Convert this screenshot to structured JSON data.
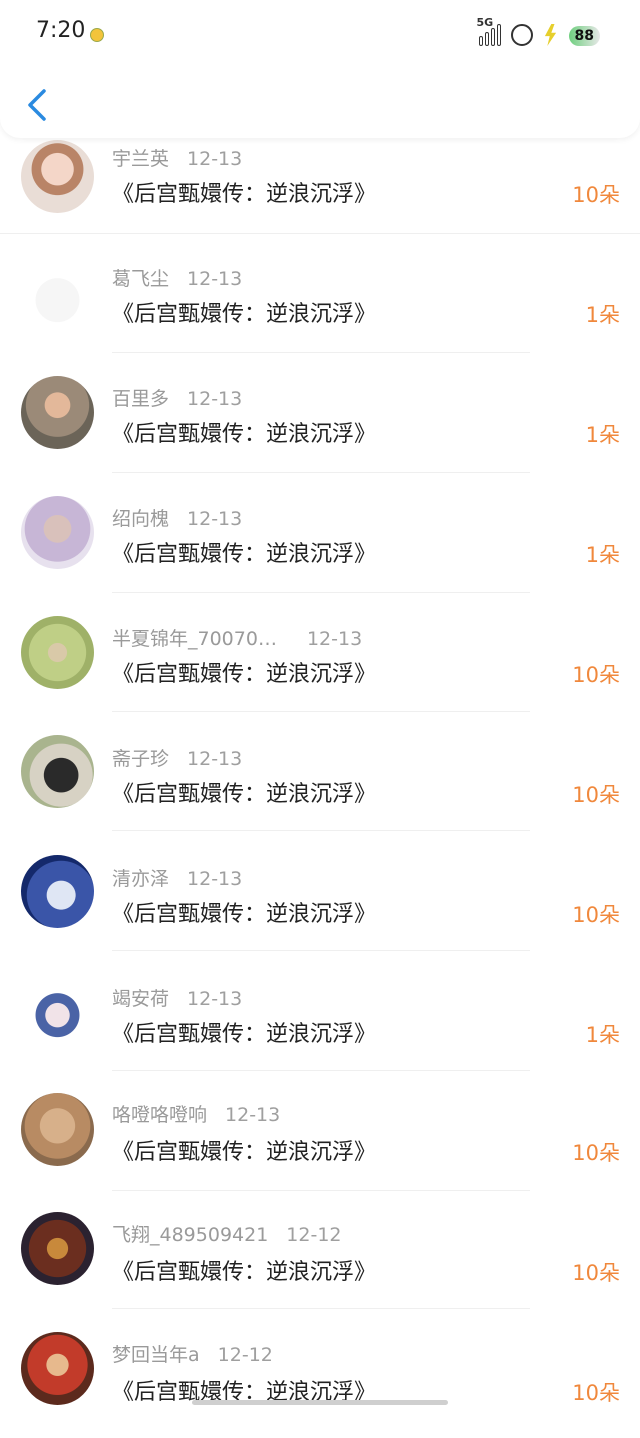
{
  "statusbar": {
    "time": "7:20",
    "signal_label": "5G",
    "battery": "88"
  },
  "header": {
    "back_icon": "chevron-left-icon"
  },
  "accent": "#f0883c",
  "items": [
    {
      "name": "宇兰英",
      "date": "12-13",
      "title": "《后宫甄嬛传：逆浪沉浮》",
      "amount": "10朵"
    },
    {
      "name": "葛飞尘",
      "date": "12-13",
      "title": "《后宫甄嬛传：逆浪沉浮》",
      "amount": "1朵"
    },
    {
      "name": "百里多",
      "date": "12-13",
      "title": "《后宫甄嬛传：逆浪沉浮》",
      "amount": "1朵"
    },
    {
      "name": "绍向槐",
      "date": "12-13",
      "title": "《后宫甄嬛传：逆浪沉浮》",
      "amount": "1朵"
    },
    {
      "name": "半夏锦年_70070…",
      "date": "12-13",
      "title": "《后宫甄嬛传：逆浪沉浮》",
      "amount": "10朵"
    },
    {
      "name": "斋子珍",
      "date": "12-13",
      "title": "《后宫甄嬛传：逆浪沉浮》",
      "amount": "10朵"
    },
    {
      "name": "清亦泽",
      "date": "12-13",
      "title": "《后宫甄嬛传：逆浪沉浮》",
      "amount": "10朵"
    },
    {
      "name": "竭安荷",
      "date": "12-13",
      "title": "《后宫甄嬛传：逆浪沉浮》",
      "amount": "1朵"
    },
    {
      "name": "咯噔咯噔响",
      "date": "12-13",
      "title": "《后宫甄嬛传：逆浪沉浮》",
      "amount": "10朵"
    },
    {
      "name": "飞翔_489509421",
      "date": "12-12",
      "title": "《后宫甄嬛传：逆浪沉浮》",
      "amount": "10朵"
    },
    {
      "name": "梦回当年a",
      "date": "12-12",
      "title": "《后宫甄嬛传：逆浪沉浮》",
      "amount": "10朵"
    }
  ]
}
